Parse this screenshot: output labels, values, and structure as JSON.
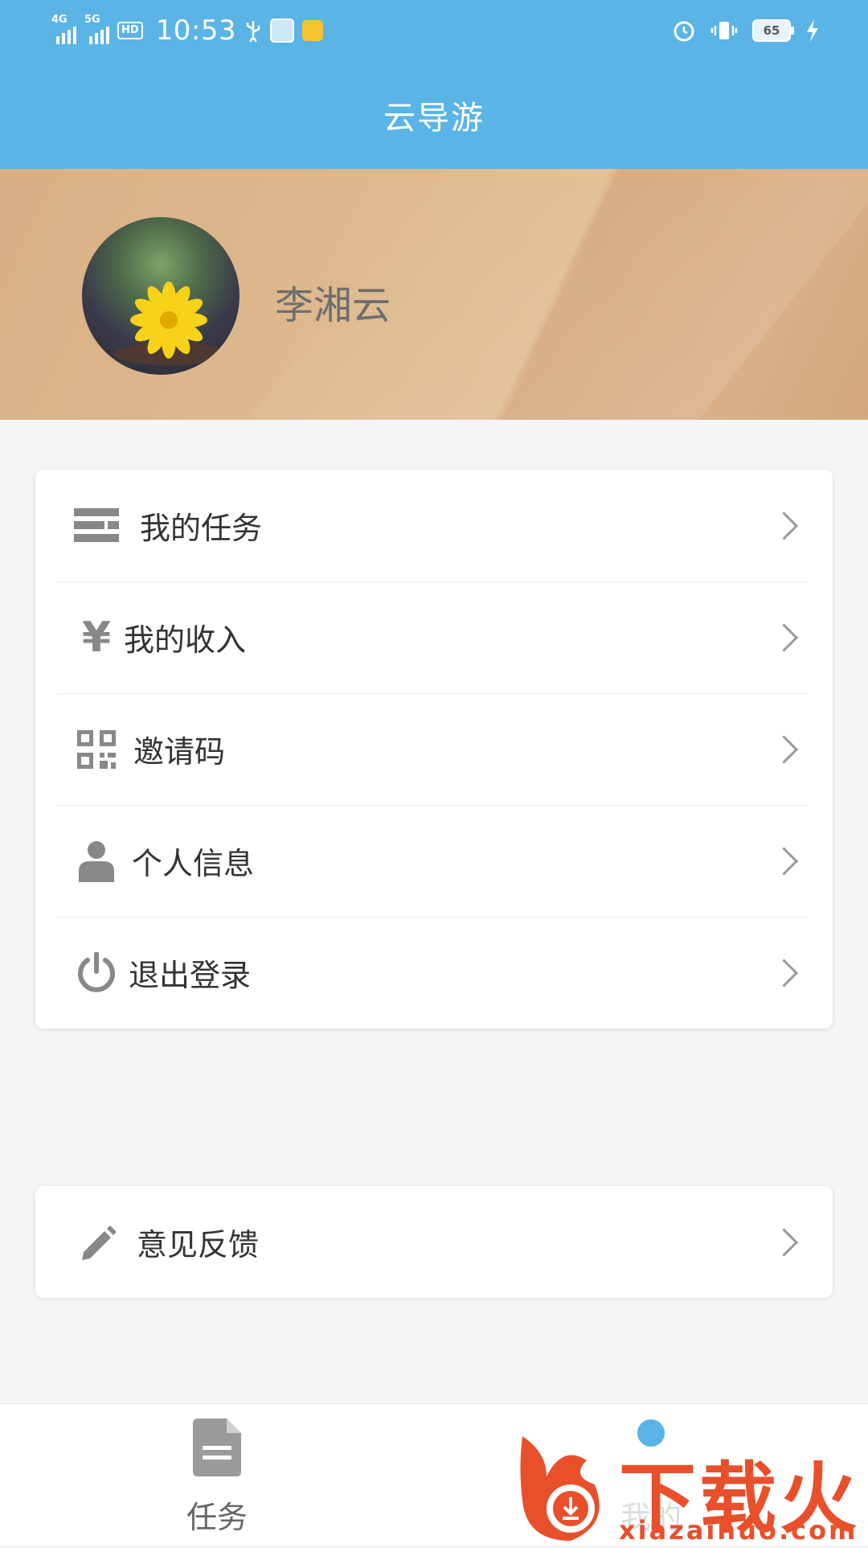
{
  "status_bar": {
    "signal_1": "4G",
    "signal_2": "5G",
    "hd": "HD",
    "time": "10:53",
    "battery": "65"
  },
  "header": {
    "title": "云导游"
  },
  "profile": {
    "name": "李湘云"
  },
  "menu": {
    "items": [
      {
        "label": "我的任务",
        "icon": "list-icon"
      },
      {
        "label": "我的收入",
        "icon": "yen-icon"
      },
      {
        "label": "邀请码",
        "icon": "qr-code-icon"
      },
      {
        "label": "个人信息",
        "icon": "person-icon"
      },
      {
        "label": "退出登录",
        "icon": "power-icon"
      }
    ]
  },
  "feedback": {
    "label": "意见反馈",
    "icon": "pencil-icon"
  },
  "tabbar": {
    "tabs": [
      {
        "label": "任务",
        "icon": "document-icon"
      },
      {
        "label": "我的",
        "icon": "person-icon"
      }
    ]
  },
  "watermark": {
    "text": "下载火",
    "url": "xiazaihuo.com"
  },
  "colors": {
    "accent": "#5ab4e6",
    "banner": "#dcb58a",
    "watermark": "#e8502b"
  }
}
